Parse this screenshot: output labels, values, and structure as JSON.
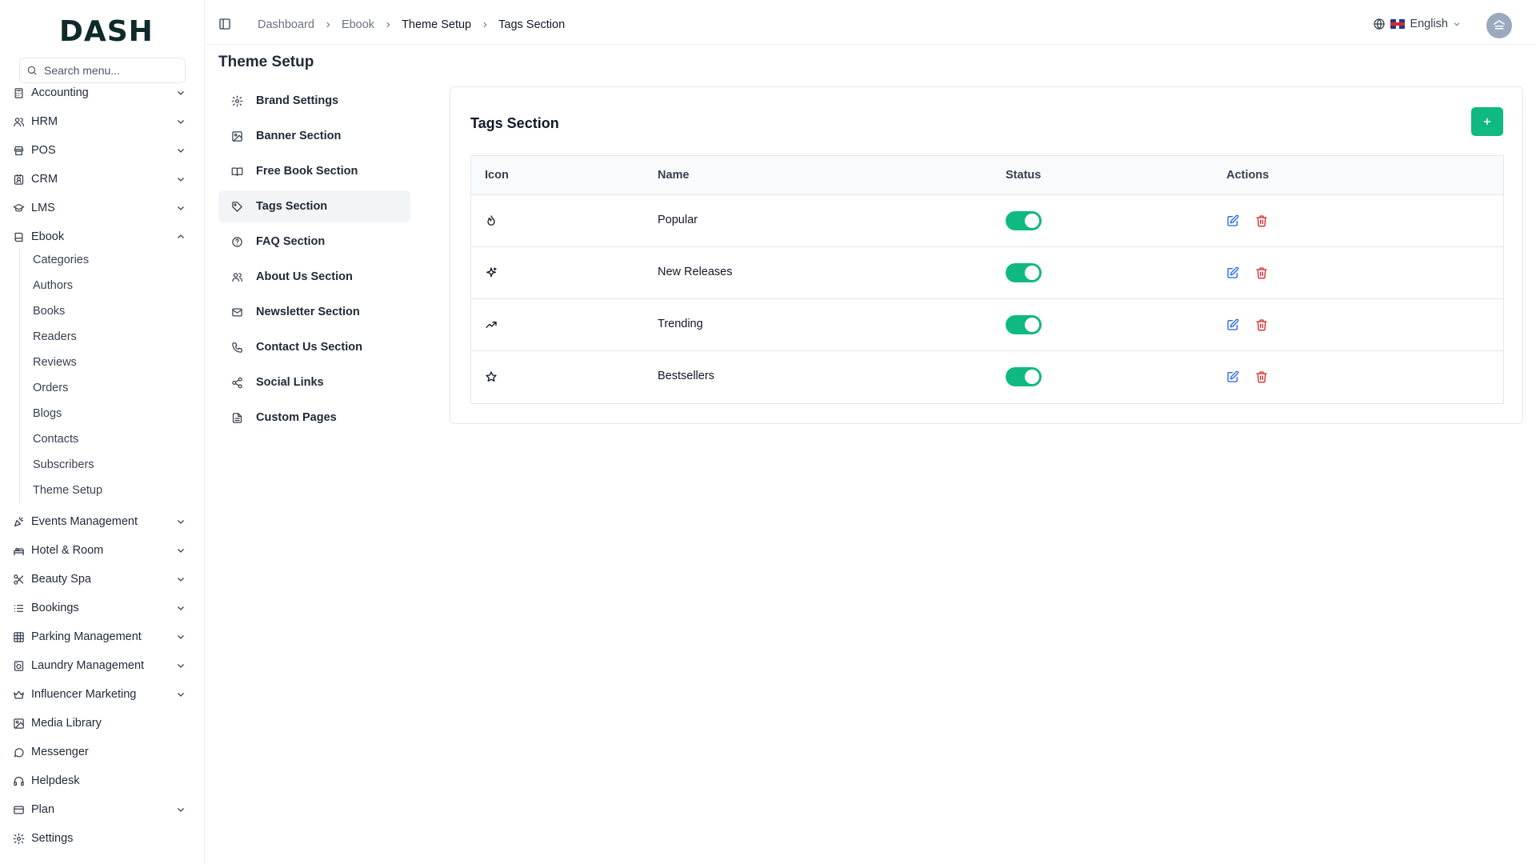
{
  "brand": {
    "logo_text": "DASH",
    "accent": "#10b981"
  },
  "sidebar": {
    "search_placeholder": "Search menu...",
    "items": [
      {
        "label": "Accounting",
        "icon": "calculator-icon",
        "chevron": "down"
      },
      {
        "label": "HRM",
        "icon": "users-icon",
        "chevron": "down"
      },
      {
        "label": "POS",
        "icon": "store-icon",
        "chevron": "down"
      },
      {
        "label": "CRM",
        "icon": "contact-icon",
        "chevron": "down"
      },
      {
        "label": "LMS",
        "icon": "graduation-cap-icon",
        "chevron": "down"
      },
      {
        "label": "Ebook",
        "icon": "book-icon",
        "chevron": "up"
      },
      {
        "label": "Events Management",
        "icon": "party-icon",
        "chevron": "down"
      },
      {
        "label": "Hotel & Room",
        "icon": "hotel-icon",
        "chevron": "down"
      },
      {
        "label": "Beauty Spa",
        "icon": "scissors-icon",
        "chevron": "down"
      },
      {
        "label": "Bookings",
        "icon": "list-icon",
        "chevron": "down"
      },
      {
        "label": "Parking Management",
        "icon": "grid-icon",
        "chevron": "down"
      },
      {
        "label": "Laundry Management",
        "icon": "washing-machine-icon",
        "chevron": "down"
      },
      {
        "label": "Influencer Marketing",
        "icon": "crown-icon",
        "chevron": "down"
      },
      {
        "label": "Media Library",
        "icon": "image-icon",
        "chevron": ""
      },
      {
        "label": "Messenger",
        "icon": "message-icon",
        "chevron": ""
      },
      {
        "label": "Helpdesk",
        "icon": "headphones-icon",
        "chevron": ""
      },
      {
        "label": "Plan",
        "icon": "credit-card-icon",
        "chevron": "down"
      },
      {
        "label": "Settings",
        "icon": "gear-icon",
        "chevron": ""
      }
    ],
    "ebook_sub": [
      "Categories",
      "Authors",
      "Books",
      "Readers",
      "Reviews",
      "Orders",
      "Blogs",
      "Contacts",
      "Subscribers",
      "Theme Setup"
    ]
  },
  "header": {
    "breadcrumb": [
      "Dashboard",
      "Ebook",
      "Theme Setup",
      "Tags Section"
    ],
    "language": "English"
  },
  "page": {
    "title": "Theme Setup"
  },
  "settings_menu": [
    {
      "label": "Brand Settings",
      "icon": "gear-icon",
      "active": false
    },
    {
      "label": "Banner Section",
      "icon": "image-icon",
      "active": false
    },
    {
      "label": "Free Book Section",
      "icon": "book-open-icon",
      "active": false
    },
    {
      "label": "Tags Section",
      "icon": "tag-icon",
      "active": true
    },
    {
      "label": "FAQ Section",
      "icon": "help-circle-icon",
      "active": false
    },
    {
      "label": "About Us Section",
      "icon": "users-icon",
      "active": false
    },
    {
      "label": "Newsletter Section",
      "icon": "mail-icon",
      "active": false
    },
    {
      "label": "Contact Us Section",
      "icon": "phone-icon",
      "active": false
    },
    {
      "label": "Social Links",
      "icon": "share-icon",
      "active": false
    },
    {
      "label": "Custom Pages",
      "icon": "file-icon",
      "active": false
    }
  ],
  "tags": {
    "title": "Tags Section",
    "add_label": "+",
    "columns": [
      "Icon",
      "Name",
      "Status",
      "Actions"
    ],
    "rows": [
      {
        "icon": "flame-icon",
        "name": "Popular",
        "status": true
      },
      {
        "icon": "sparkles-icon",
        "name": "New Releases",
        "status": true
      },
      {
        "icon": "trending-up-icon",
        "name": "Trending",
        "status": true
      },
      {
        "icon": "star-icon",
        "name": "Bestsellers",
        "status": true
      }
    ]
  }
}
